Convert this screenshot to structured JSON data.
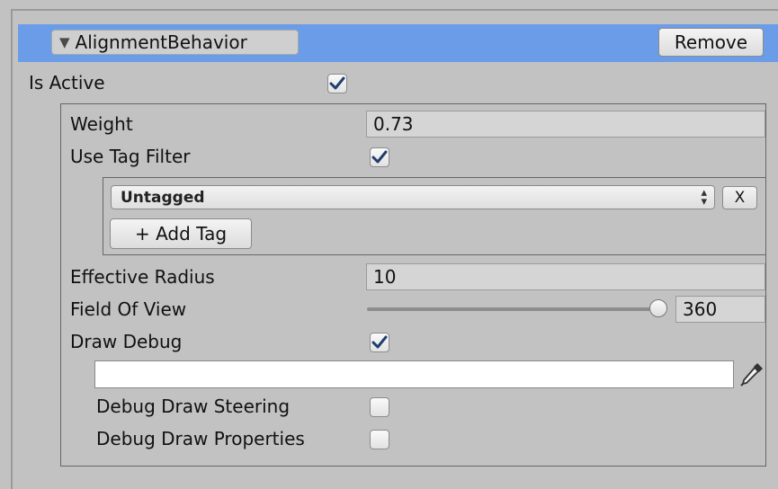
{
  "component": {
    "title": "AlignmentBehavior",
    "remove_label": "Remove",
    "is_active_label": "Is Active",
    "is_active": true
  },
  "properties": {
    "weight_label": "Weight",
    "weight_value": "0.73",
    "use_tag_filter_label": "Use Tag Filter",
    "use_tag_filter": true,
    "tag_selected": "Untagged",
    "tag_remove_label": "X",
    "add_tag_label": "+ Add Tag",
    "effective_radius_label": "Effective Radius",
    "effective_radius_value": "10",
    "field_of_view_label": "Field Of View",
    "field_of_view_value": "360",
    "field_of_view_fraction": 1.0,
    "draw_debug_label": "Draw Debug",
    "draw_debug": true,
    "debug_color": "#ffffff",
    "debug_draw_steering_label": "Debug Draw Steering",
    "debug_draw_steering": false,
    "debug_draw_properties_label": "Debug Draw Properties",
    "debug_draw_properties": false
  },
  "colors": {
    "header": "#6b9ce7",
    "panel": "#c2c2c2",
    "check": "#1f3f6e"
  },
  "icons": [
    "foldout-triangle-icon",
    "checkmark-icon",
    "dropdown-arrows-icon",
    "eyedropper-icon"
  ]
}
